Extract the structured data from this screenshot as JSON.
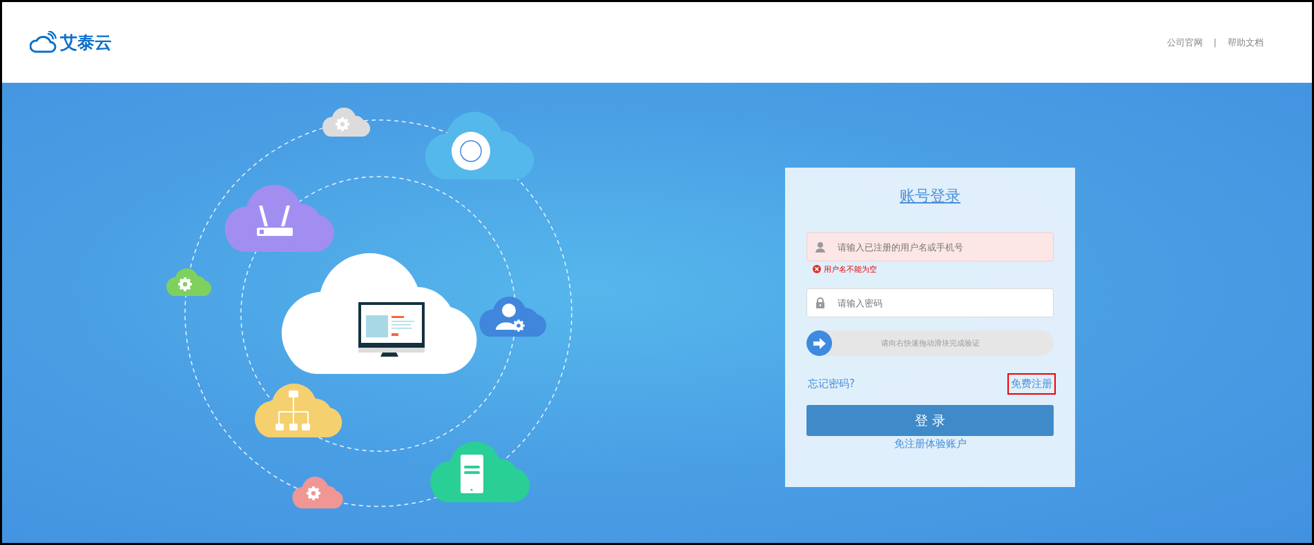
{
  "header": {
    "logo": "艾泰云",
    "links": [
      "公司官网",
      "帮助文档"
    ],
    "separator": "|"
  },
  "login": {
    "title": "账号登录",
    "fields": [
      {
        "kind": "text",
        "placeholder": "请输入已注册的用户名或手机号",
        "error": true,
        "error_message": "用户名不能为空"
      },
      {
        "kind": "password",
        "placeholder": "请输入密码",
        "error": false
      }
    ],
    "slider": {
      "label": "请向右快速拖动滑块完成验证",
      "level": 0
    },
    "forgot": "忘记密码?",
    "register": {
      "label": "免费注册",
      "highlighted": true
    },
    "submit": "登 录",
    "trial": "免注册体验账户"
  }
}
